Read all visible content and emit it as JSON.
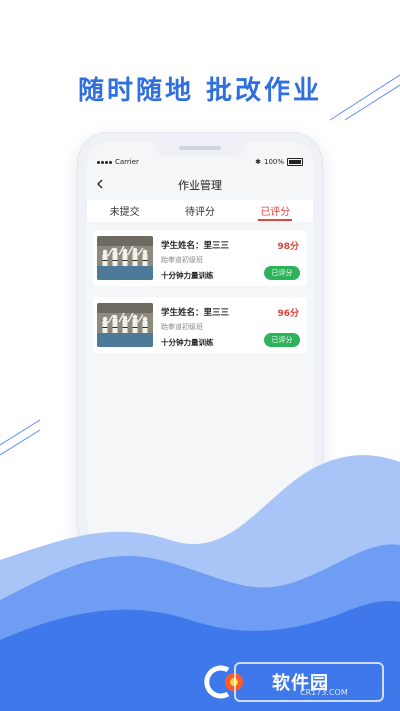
{
  "headline": "随时随地 批改作业",
  "status_bar": {
    "carrier": "Carrier",
    "battery": "100%"
  },
  "nav": {
    "title": "作业管理"
  },
  "tabs": [
    {
      "label": "未提交",
      "active": false
    },
    {
      "label": "待评分",
      "active": false
    },
    {
      "label": "已评分",
      "active": true
    }
  ],
  "cards": [
    {
      "name": "学生姓名：里三三",
      "class": "跆拳道初级班",
      "task": "十分钟力量训练",
      "score": "98分",
      "status": "已评分"
    },
    {
      "name": "学生姓名：里三三",
      "class": "跆拳道初级班",
      "task": "十分钟力量训练",
      "score": "96分",
      "status": "已评分"
    }
  ],
  "watermark": {
    "brand": "软件园",
    "site": "CR173.COM"
  },
  "colors": {
    "accent": "#2f6fe0",
    "active_tab": "#e2463b",
    "score": "#d9443a",
    "badge": "#2fb35a",
    "wave": "#4a85f0"
  }
}
